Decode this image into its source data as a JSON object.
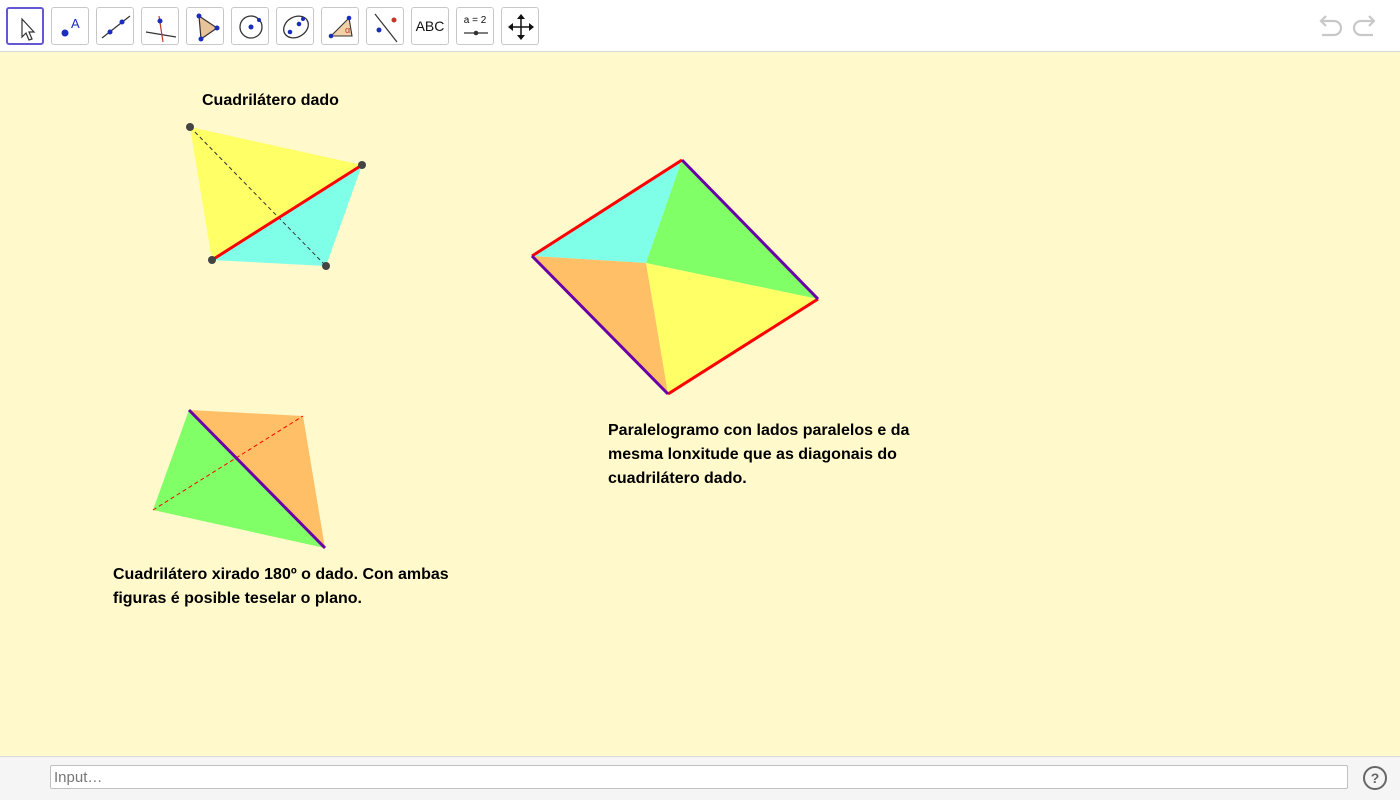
{
  "toolbar": {
    "tools": [
      {
        "name": "move-tool",
        "icon": "cursor-arrow-icon"
      },
      {
        "name": "point-tool",
        "icon": "point-icon"
      },
      {
        "name": "line-tool",
        "icon": "line-through-points-icon"
      },
      {
        "name": "perpendicular-line-tool",
        "icon": "perpendicular-line-icon"
      },
      {
        "name": "polygon-tool",
        "icon": "polygon-icon"
      },
      {
        "name": "circle-tool",
        "icon": "circle-center-point-icon"
      },
      {
        "name": "conic-tool",
        "icon": "ellipse-icon"
      },
      {
        "name": "angle-tool",
        "icon": "angle-icon"
      },
      {
        "name": "reflect-tool",
        "icon": "reflect-about-line-icon"
      },
      {
        "name": "text-tool",
        "label": "ABC"
      },
      {
        "name": "slider-tool",
        "label": "a = 2"
      },
      {
        "name": "move-graphics-view-tool",
        "icon": "move-arrows-icon"
      }
    ],
    "undo_icon": "undo-icon",
    "redo_icon": "redo-icon"
  },
  "canvas": {
    "background": "#fff9cc",
    "colors": {
      "yellow": "#ffff66",
      "cyan": "#80ffe8",
      "green": "#80ff66",
      "orange": "#ffbf66",
      "red": "#ff0000",
      "purple": "#6a00a8"
    },
    "labels": {
      "given_title": "Cuadrilátero dado",
      "parallelogram_line1": "Paralelogramo con lados paralelos e da",
      "parallelogram_line2": "mesma lonxitude que as diagonais do",
      "parallelogram_line3": "cuadrilátero dado.",
      "rotated_line1": "Cuadrilátero xirado 180º o dado. Con ambas",
      "rotated_line2": "figuras é posible teselar o plano."
    }
  },
  "input_bar": {
    "placeholder": "Input…",
    "help_icon": "help-icon",
    "help_label": "?"
  }
}
